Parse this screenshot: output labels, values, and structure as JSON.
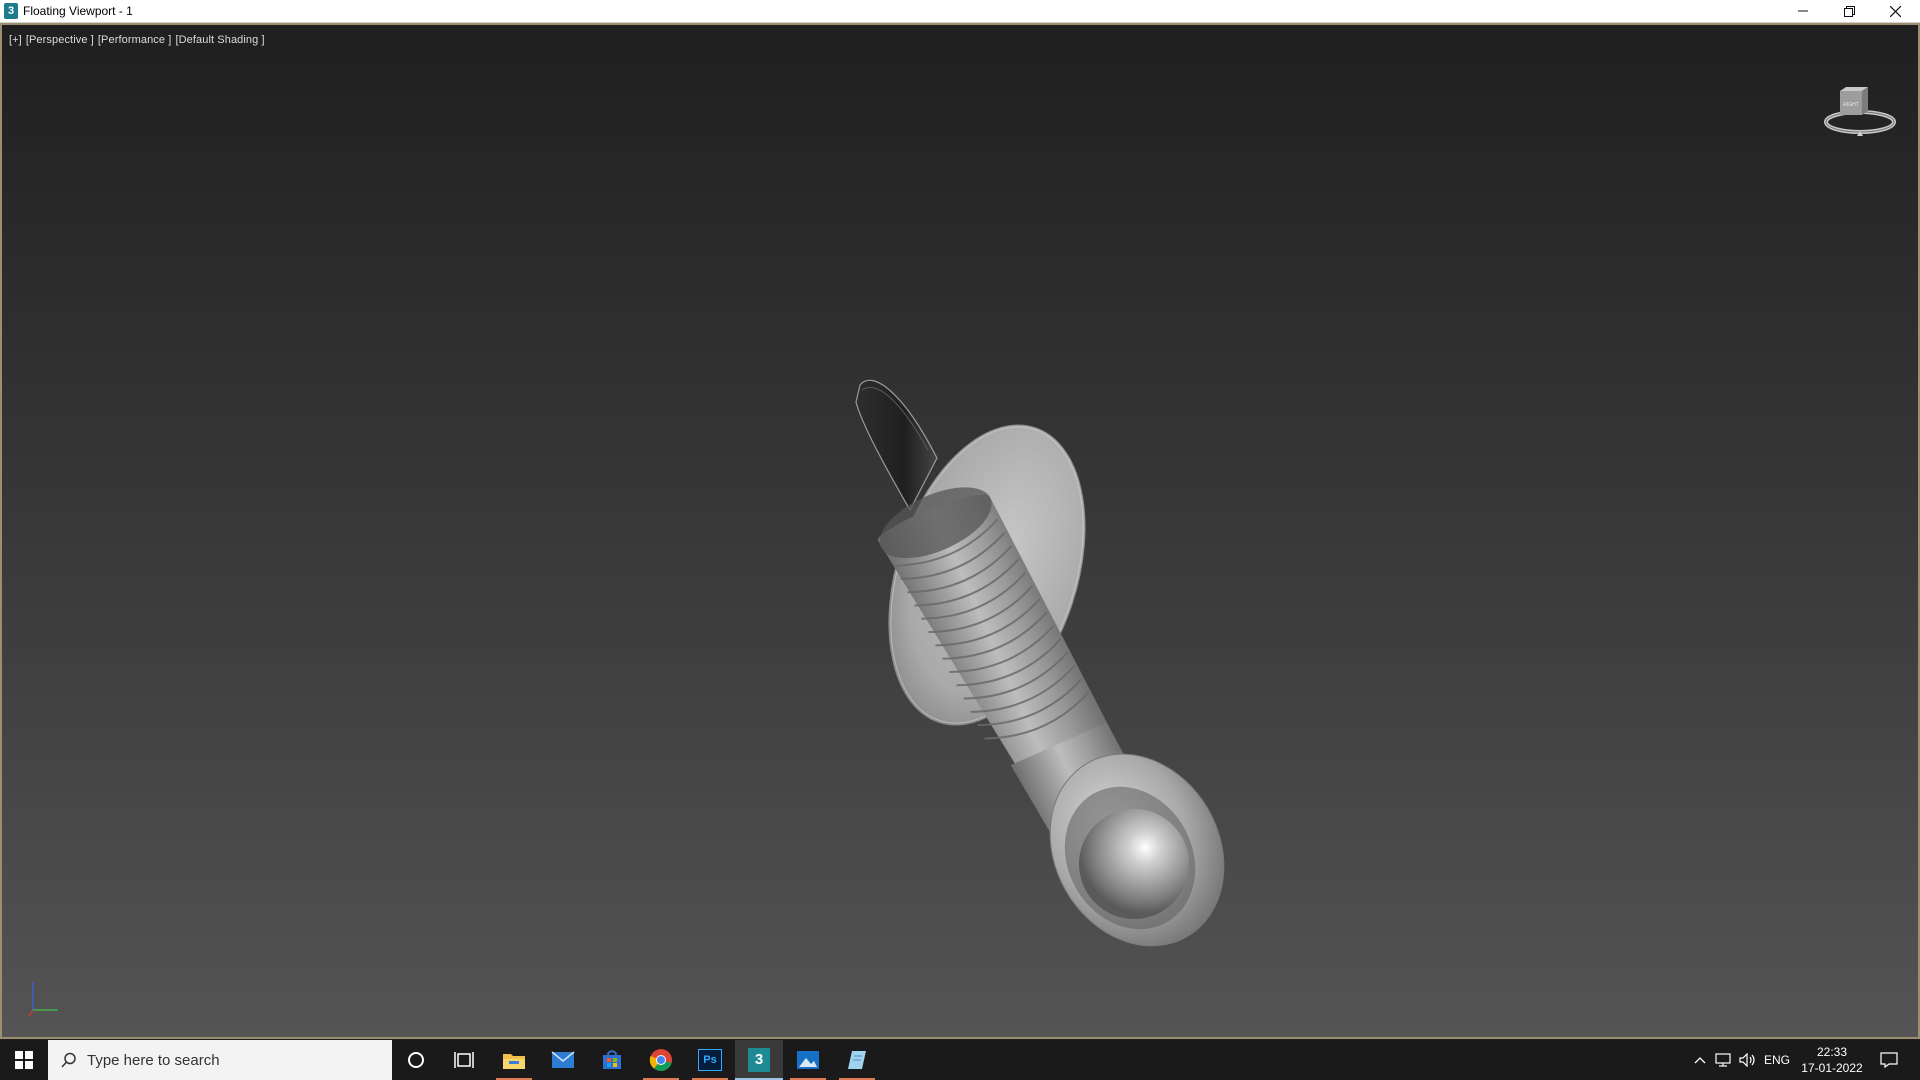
{
  "window": {
    "title": "Floating Viewport - 1",
    "app_icon_label": "3",
    "controls": [
      "minimize-icon",
      "restore-icon",
      "close-icon"
    ]
  },
  "viewport": {
    "labels": [
      "[+]",
      "[Perspective ]",
      "[Performance ]",
      "[Default Shading ]"
    ],
    "viewcube_face": "RIGHT",
    "border_color": "#9a8f6e"
  },
  "taskbar": {
    "search_placeholder": "Type here to search",
    "pinned_icons": [
      "cortana-icon",
      "task-view-icon",
      "file-explorer-icon",
      "mail-icon",
      "microsoft-store-icon",
      "chrome-icon",
      "photoshop-icon",
      "3ds-max-icon",
      "photos-icon",
      "notes-icon"
    ],
    "photoshop_label": "Ps",
    "max_label": "3",
    "tray": {
      "language": "ENG",
      "time": "22:33",
      "date": "17-01-2022"
    }
  },
  "colors": {
    "taskbar_bg": "#1a1a1a",
    "accent_underline": "#e07a53",
    "active_underline": "#9fc2e7"
  }
}
